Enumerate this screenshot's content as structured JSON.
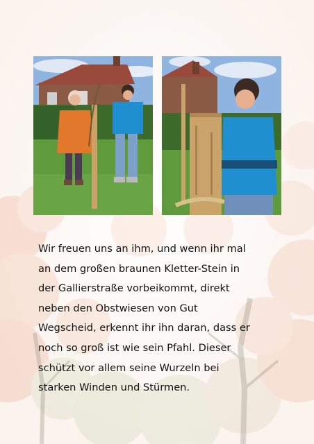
{
  "page": {
    "paragraph_lines": [
      "Wir freuen uns an ihm, und wenn ihr mal",
      "an dem großen braunen Kletter-Stein in",
      "der Gallierstraße vorbeikommt, direkt",
      "neben den Obstwiesen von Gut",
      "Wegscheid, erkennt ihr ihn daran, dass er",
      "noch so groß ist wie sein Pfahl. Dieser",
      "schützt vor allem seine Wurzeln bei",
      "starken Winden und Stürmen."
    ]
  },
  "colors": {
    "sky": "#8fb4e0",
    "brick": "#8a5a45",
    "grass": "#5f9a3c",
    "hedge": "#3d6b2c",
    "orange_jacket": "#e2782c",
    "blue_jacket": "#1f8fd0",
    "wood": "#c9a36a",
    "text": "#111111"
  }
}
